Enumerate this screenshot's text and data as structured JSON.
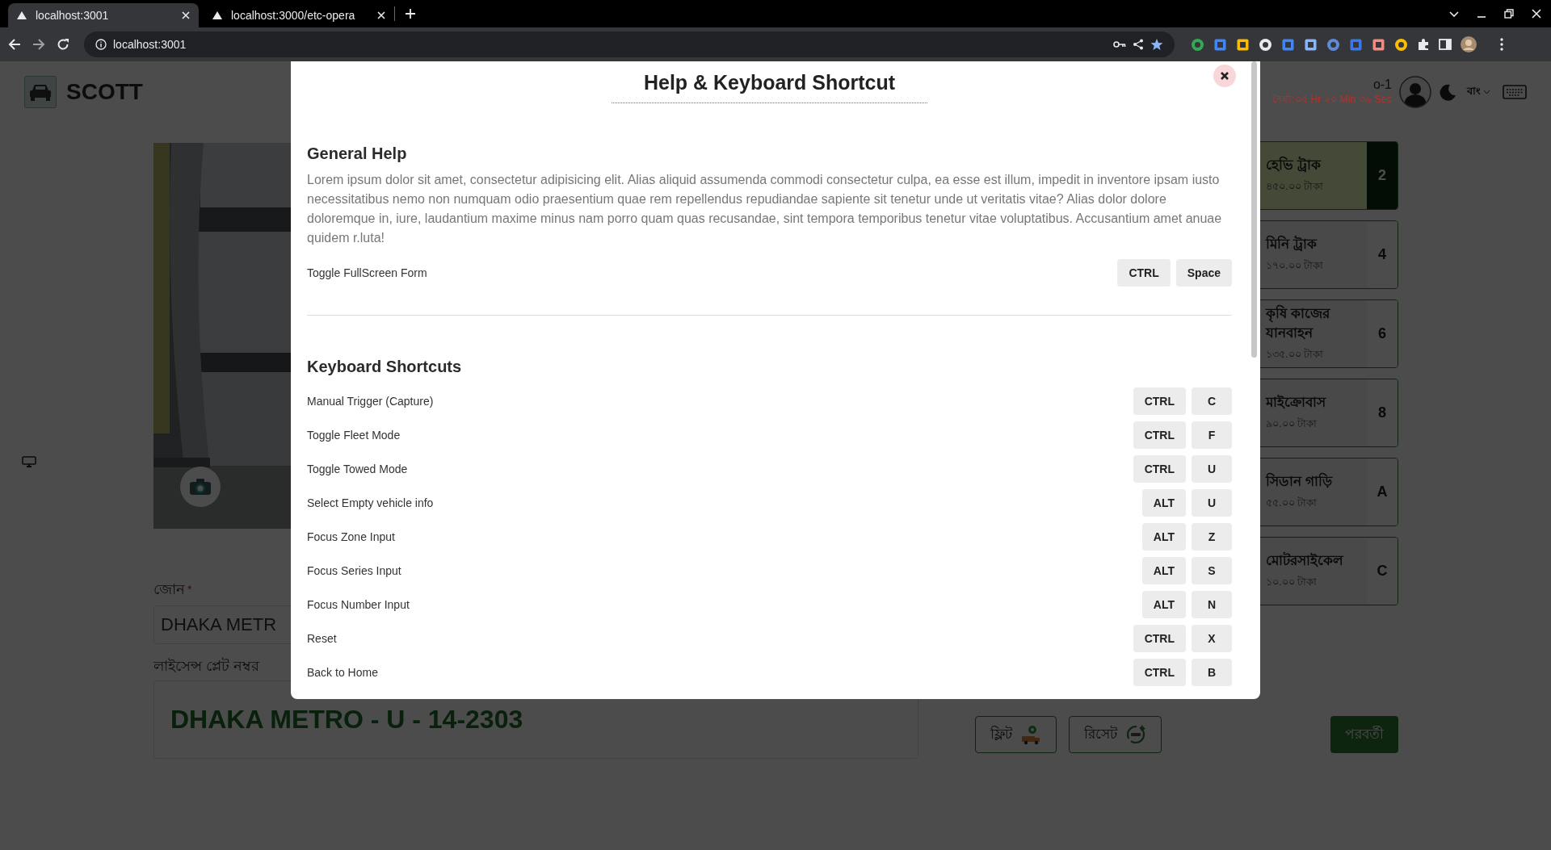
{
  "browser": {
    "tabs": [
      {
        "title": "localhost:3001",
        "selected": true
      },
      {
        "title": "localhost:3000/etc-opera",
        "selected": false
      }
    ],
    "address": "localhost:3001"
  },
  "header": {
    "brand": "SCOTT",
    "booth": "o-1",
    "duration": "দৈর্ঘ্য:০৫ Hr ২০ Min ৩৯ Sec",
    "language": "বাং"
  },
  "form": {
    "zone_label": "জোন",
    "required_mark": "*",
    "zone_value": "DHAKA METR",
    "plate_label": "লাইসেন্স প্লেট নম্বর",
    "plate_value": "DHAKA METRO - U - 14-2303"
  },
  "vehicle_classes": [
    {
      "name": "হেভি ট্রাক",
      "price": "৪৫০.০০ টাকা",
      "key": "2",
      "selected": true
    },
    {
      "name": "মিনি ট্রাক",
      "price": "১৭০.০০ টাকা",
      "key": "4",
      "selected": false
    },
    {
      "name": "কৃষি কাজের যানবাহন",
      "price": "১৩৫.০০ টাকা",
      "key": "6",
      "selected": false
    },
    {
      "name": "মাইক্রোবাস",
      "price": "৯০.০০ টাকা",
      "key": "8",
      "selected": false
    },
    {
      "name": "সিডান গাড়ি",
      "price": "৫৫.০০ টাকা",
      "key": "A",
      "selected": false
    },
    {
      "name": "মোটরসাইকেল",
      "price": "১০.০০ টাকা",
      "key": "C",
      "selected": false
    }
  ],
  "actions": [
    {
      "label": "ফ্লিট",
      "kind": "fleet"
    },
    {
      "label": "রিসেট",
      "kind": "reset"
    },
    {
      "label": "পরবর্তী",
      "kind": "next"
    }
  ],
  "modal": {
    "title": "Help & Keyboard Shortcut",
    "sections": [
      {
        "heading": "General Help",
        "text": "Lorem ipsum dolor sit amet, consectetur adipisicing elit. Alias aliquid assumenda commodi consectetur culpa, ea esse est illum, impedit in inventore ipsam iusto necessitatibus nemo non numquam odio praesentium quae rem repellendus repudiandae sapiente sit tenetur unde ut veritatis vitae? Alias dolor dolore doloremque in, iure, laudantium maxime minus nam porro quam quas recusandae, sint tempora temporibus tenetur vitae voluptatibus. Accusantium amet anuae quidem r.luta!",
        "shortcuts": [
          {
            "action": "Toggle FullScreen Form",
            "keys": [
              "CTRL",
              "Space"
            ]
          }
        ]
      },
      {
        "heading": "Keyboard Shortcuts",
        "shortcuts": [
          {
            "action": "Manual Trigger (Capture)",
            "keys": [
              "CTRL",
              "C"
            ]
          },
          {
            "action": "Toggle Fleet Mode",
            "keys": [
              "CTRL",
              "F"
            ]
          },
          {
            "action": "Toggle Towed Mode",
            "keys": [
              "CTRL",
              "U"
            ]
          },
          {
            "action": "Select Empty vehicle info",
            "keys": [
              "ALT",
              "U"
            ]
          },
          {
            "action": "Focus Zone Input",
            "keys": [
              "ALT",
              "Z"
            ]
          },
          {
            "action": "Focus Series Input",
            "keys": [
              "ALT",
              "S"
            ]
          },
          {
            "action": "Focus Number Input",
            "keys": [
              "ALT",
              "N"
            ]
          },
          {
            "action": "Reset",
            "keys": [
              "CTRL",
              "X"
            ]
          },
          {
            "action": "Back to Home",
            "keys": [
              "CTRL",
              "B"
            ]
          }
        ]
      }
    ]
  }
}
